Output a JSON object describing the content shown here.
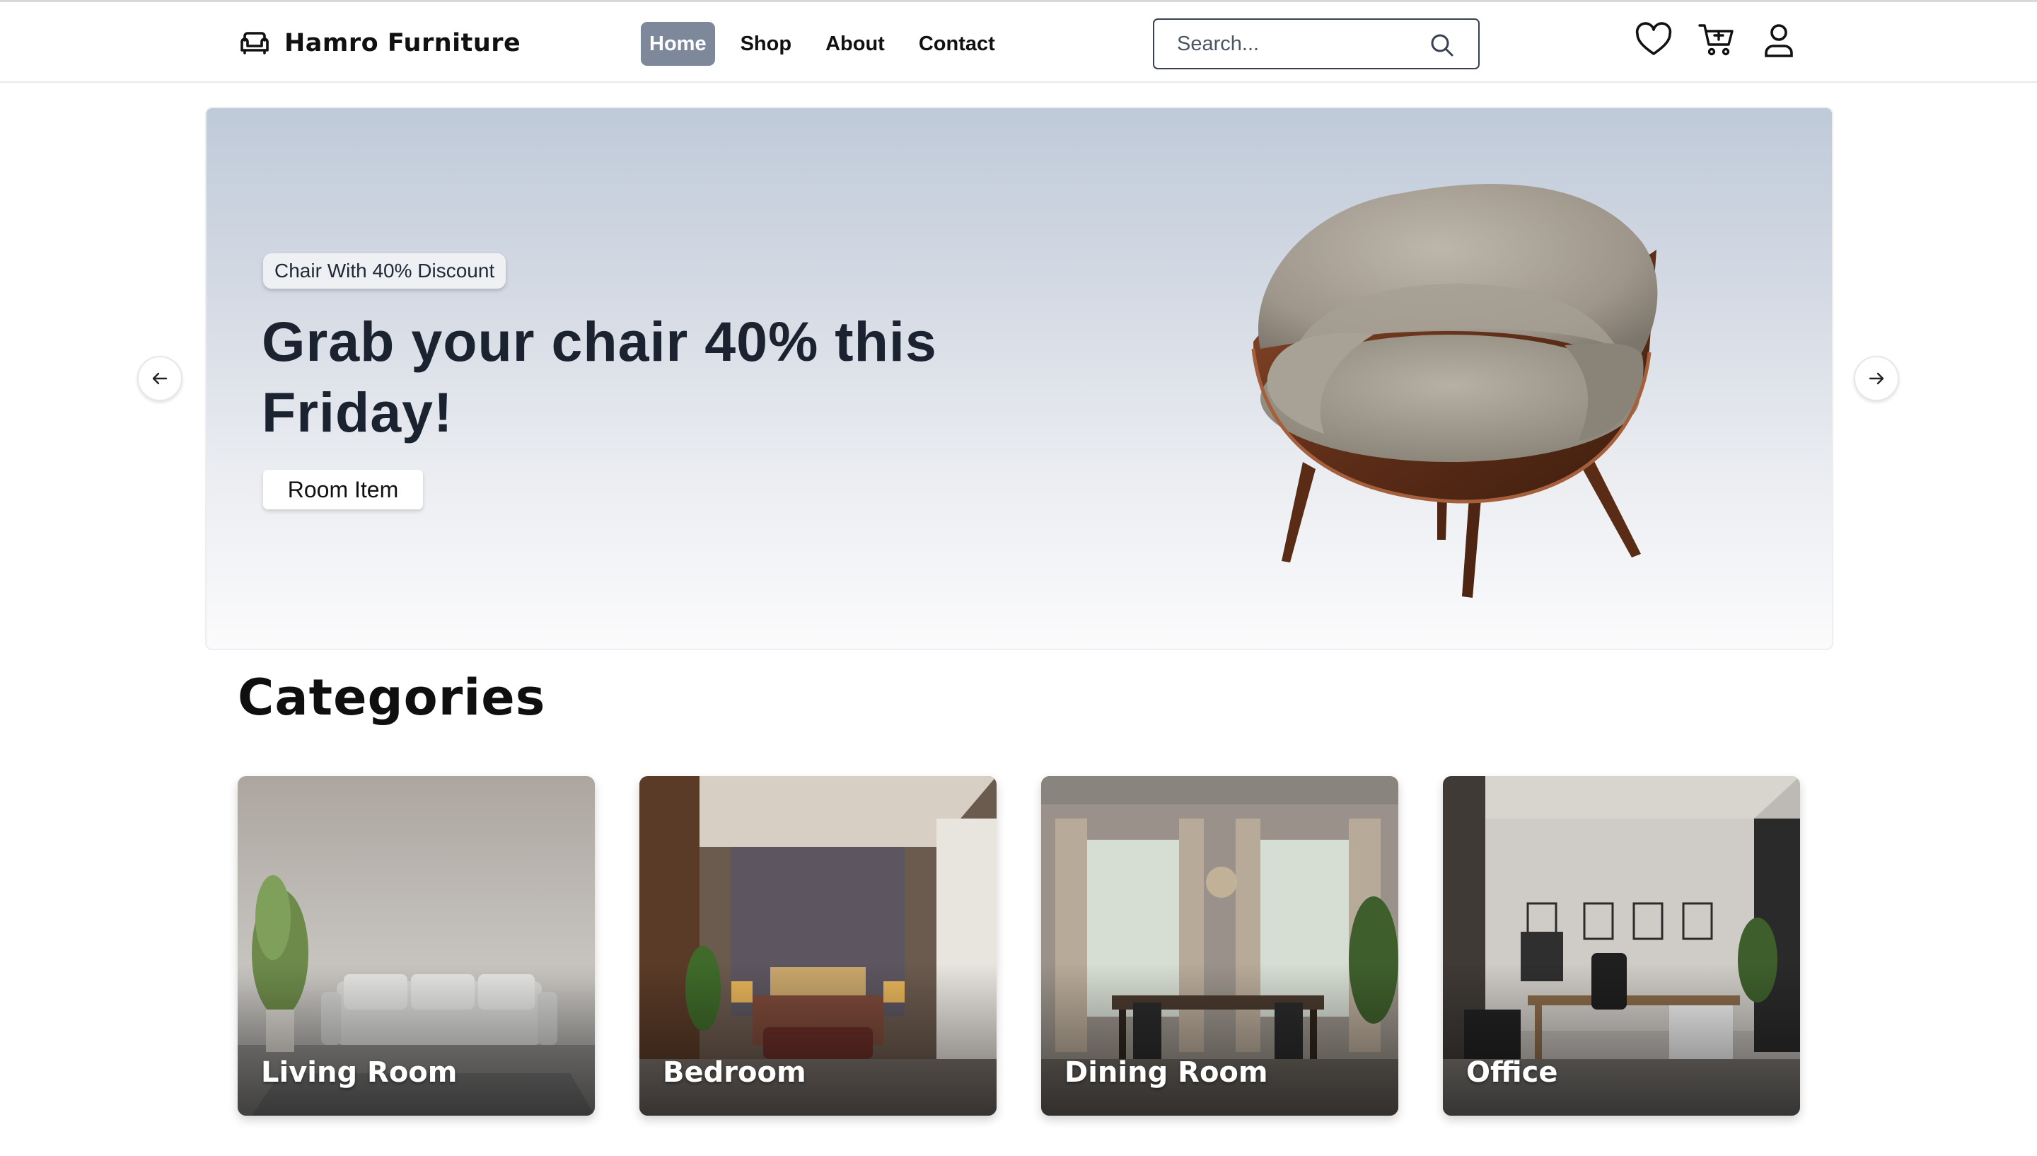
{
  "header": {
    "brand": "Hamro Furniture",
    "brand_icon": "sofa-icon",
    "nav": [
      {
        "label": "Home",
        "active": true
      },
      {
        "label": "Shop",
        "active": false
      },
      {
        "label": "About",
        "active": false
      },
      {
        "label": "Contact",
        "active": false
      }
    ],
    "search": {
      "placeholder": "Search...",
      "value": "",
      "icon": "search-icon"
    },
    "icons": [
      "heart-icon",
      "cart-plus-icon",
      "user-icon"
    ],
    "active_nav_color": "#7d889a"
  },
  "hero": {
    "badge": "Chair With 40% Discount",
    "title": "Grab your chair 40% this Friday!",
    "button": "Room Item",
    "image": "armchair-image",
    "prev_icon": "arrow-left-icon",
    "next_icon": "arrow-right-icon"
  },
  "categories": {
    "heading": "Categories",
    "items": [
      {
        "label": "Living Room",
        "image": "living-room-image"
      },
      {
        "label": "Bedroom",
        "image": "bedroom-image"
      },
      {
        "label": "Dining Room",
        "image": "dining-room-image"
      },
      {
        "label": "Office",
        "image": "office-image"
      }
    ]
  }
}
